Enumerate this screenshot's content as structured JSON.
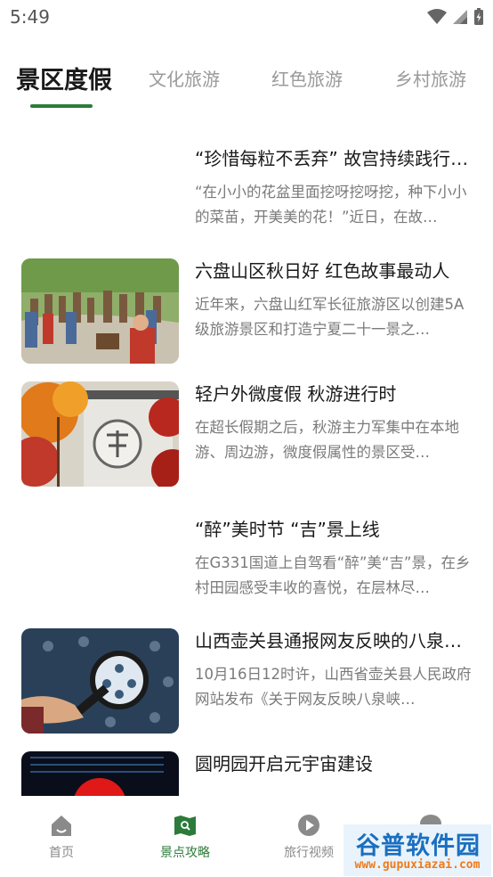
{
  "status_bar": {
    "time": "5:49"
  },
  "tabs": [
    {
      "label": "景区度假",
      "active": true
    },
    {
      "label": "文化旅游",
      "active": false
    },
    {
      "label": "红色旅游",
      "active": false
    },
    {
      "label": "乡村旅游",
      "active": false
    }
  ],
  "articles": [
    {
      "title": "“珍惜每粒不丢弃” 故宫持续践行“…",
      "summary": "“在小小的花盆里面挖呀挖呀挖，种下小小的菜苗，开美美的花！”近日，在故…",
      "has_image": false
    },
    {
      "title": "六盘山区秋日好 红色故事最动人",
      "summary": "近年来，六盘山红军长征旅游区以创建5A级旅游景区和打造宁夏二十一景之…",
      "has_image": true,
      "image": "red-army-statues-photo"
    },
    {
      "title": "轻户外微度假 秋游进行时",
      "summary": "在超长假期之后，秋游主力军集中在本地游、周边游，微度假属性的景区受…",
      "has_image": true,
      "image": "autumn-wall-photo"
    },
    {
      "title": "“醉”美时节 “吉”景上线",
      "summary": "在G331国道上自驾看“醉”美“吉”景，在乡村田园感受丰收的喜悦，在层林尽…",
      "has_image": false
    },
    {
      "title": "山西壶关县通报网友反映的八泉…",
      "summary": "10月16日12时许，山西省壶关县人民政府网站发布《关于网友反映八泉峡…",
      "has_image": true,
      "image": "magnifier-network-photo"
    },
    {
      "title": "圆明园开启元宇宙建设",
      "summary": "",
      "has_image": true,
      "image": "digital-globe-photo"
    }
  ],
  "bottom_nav": [
    {
      "label": "首页",
      "icon": "home-icon",
      "active": false
    },
    {
      "label": "景点攻略",
      "icon": "map-search-icon",
      "active": true
    },
    {
      "label": "旅行视频",
      "icon": "play-icon",
      "active": false
    },
    {
      "label": "",
      "icon": "chat-icon",
      "active": false
    }
  ],
  "watermark": {
    "title": "谷普软件园",
    "url": "www.gupuxiazai.com"
  },
  "colors": {
    "accent": "#2c7b3a",
    "inactive_tab": "#9a9a9a",
    "summary_text": "#7a7a7a"
  }
}
